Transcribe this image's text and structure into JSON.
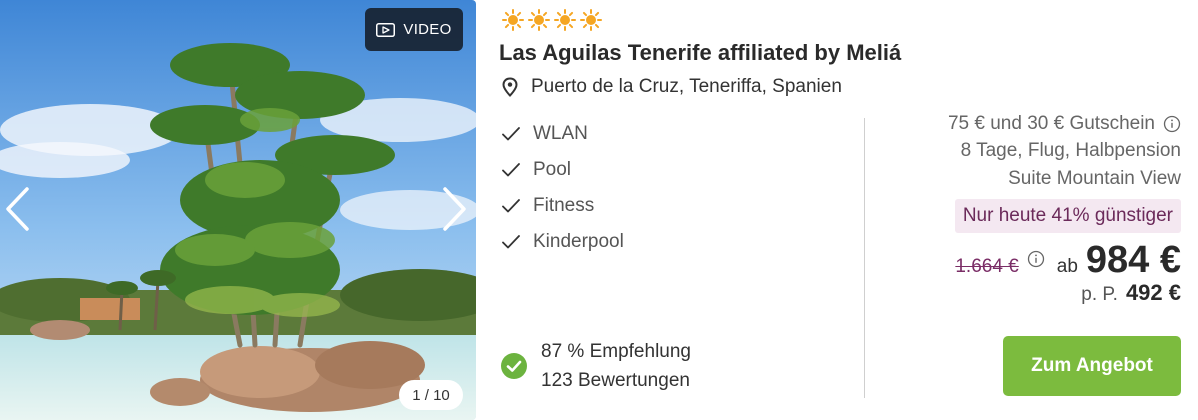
{
  "gallery": {
    "video_label": "VIDEO",
    "counter": "1 / 10",
    "icons": {
      "video": "play-video-icon",
      "prev": "chevron-left-icon",
      "next": "chevron-right-icon"
    }
  },
  "hotel": {
    "stars": 4,
    "star_icon": "sun-icon",
    "star_color": "#f5a623",
    "name": "Las Aguilas Tenerife affiliated by Meliá",
    "location": "Puerto de la Cruz, Teneriffa, Spanien",
    "location_icon": "map-pin-icon"
  },
  "amenities": [
    "WLAN",
    "Pool",
    "Fitness",
    "Kinderpool"
  ],
  "rating": {
    "recommendation": "87 % Empfehlung",
    "reviews": "123 Bewertungen",
    "icon": "check-circle-icon",
    "icon_color": "#6cb33f"
  },
  "pricing": {
    "voucher": "75 € und 30 € Gutschein",
    "package": "8 Tage, Flug, Halbpension",
    "room": "Suite Mountain View",
    "discount": "Nur heute 41% günstiger",
    "old_price": "1.664 €",
    "from_label": "ab",
    "price": "984 €",
    "per_person_label": "p. P.",
    "per_person_price": "492 €",
    "accent_color": "#7a2d66"
  },
  "cta": {
    "label": "Zum Angebot",
    "color": "#7cbb3e"
  }
}
